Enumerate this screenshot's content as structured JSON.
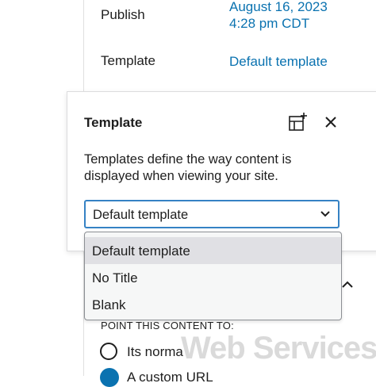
{
  "summary": {
    "publish_label": "Publish",
    "publish_date": "August 16, 2023",
    "publish_time": "4:28 pm CDT",
    "template_label": "Template",
    "template_value": "Default template"
  },
  "popover": {
    "title": "Template",
    "description": "Templates define the way content is displayed when viewing your site.",
    "add_icon": "add-template-icon",
    "close_icon": "close-icon"
  },
  "select": {
    "value": "Default template",
    "options": [
      "Default template",
      "No Title",
      "Blank"
    ],
    "selected_index": 0
  },
  "below": {
    "point_label": "POINT THIS CONTENT TO:",
    "radio1_label": "Its norma",
    "radio2_label": "A custom URL"
  },
  "watermark": "Web Services",
  "colors": {
    "link": "#0a72b0",
    "focus": "#3582c4"
  }
}
